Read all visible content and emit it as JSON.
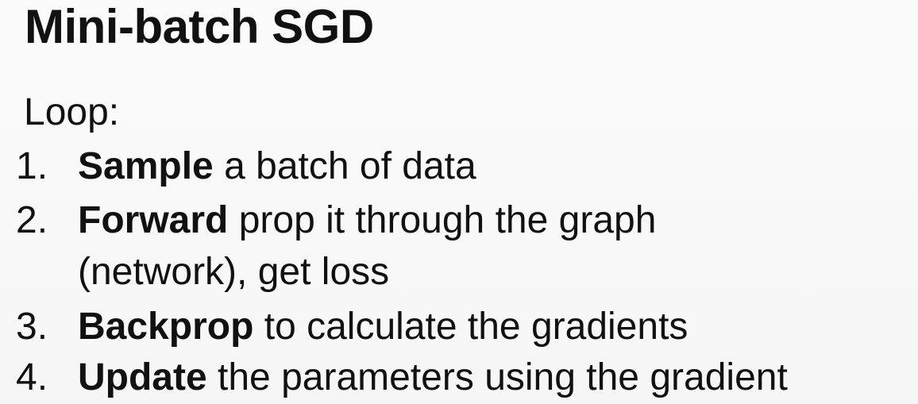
{
  "slide": {
    "title": "Mini-batch SGD",
    "loop_label": "Loop:",
    "items": [
      {
        "number": "1.",
        "keyword": "Sample",
        "rest": " a batch of data"
      },
      {
        "number": "2.",
        "keyword": "Forward",
        "rest": " prop it through the graph",
        "continuation": "(network), get loss"
      },
      {
        "number": "3.",
        "keyword": "Backprop",
        "rest": " to calculate the gradients"
      },
      {
        "number": "4.",
        "keyword": "Update",
        "rest": " the parameters using the gradient"
      }
    ]
  }
}
